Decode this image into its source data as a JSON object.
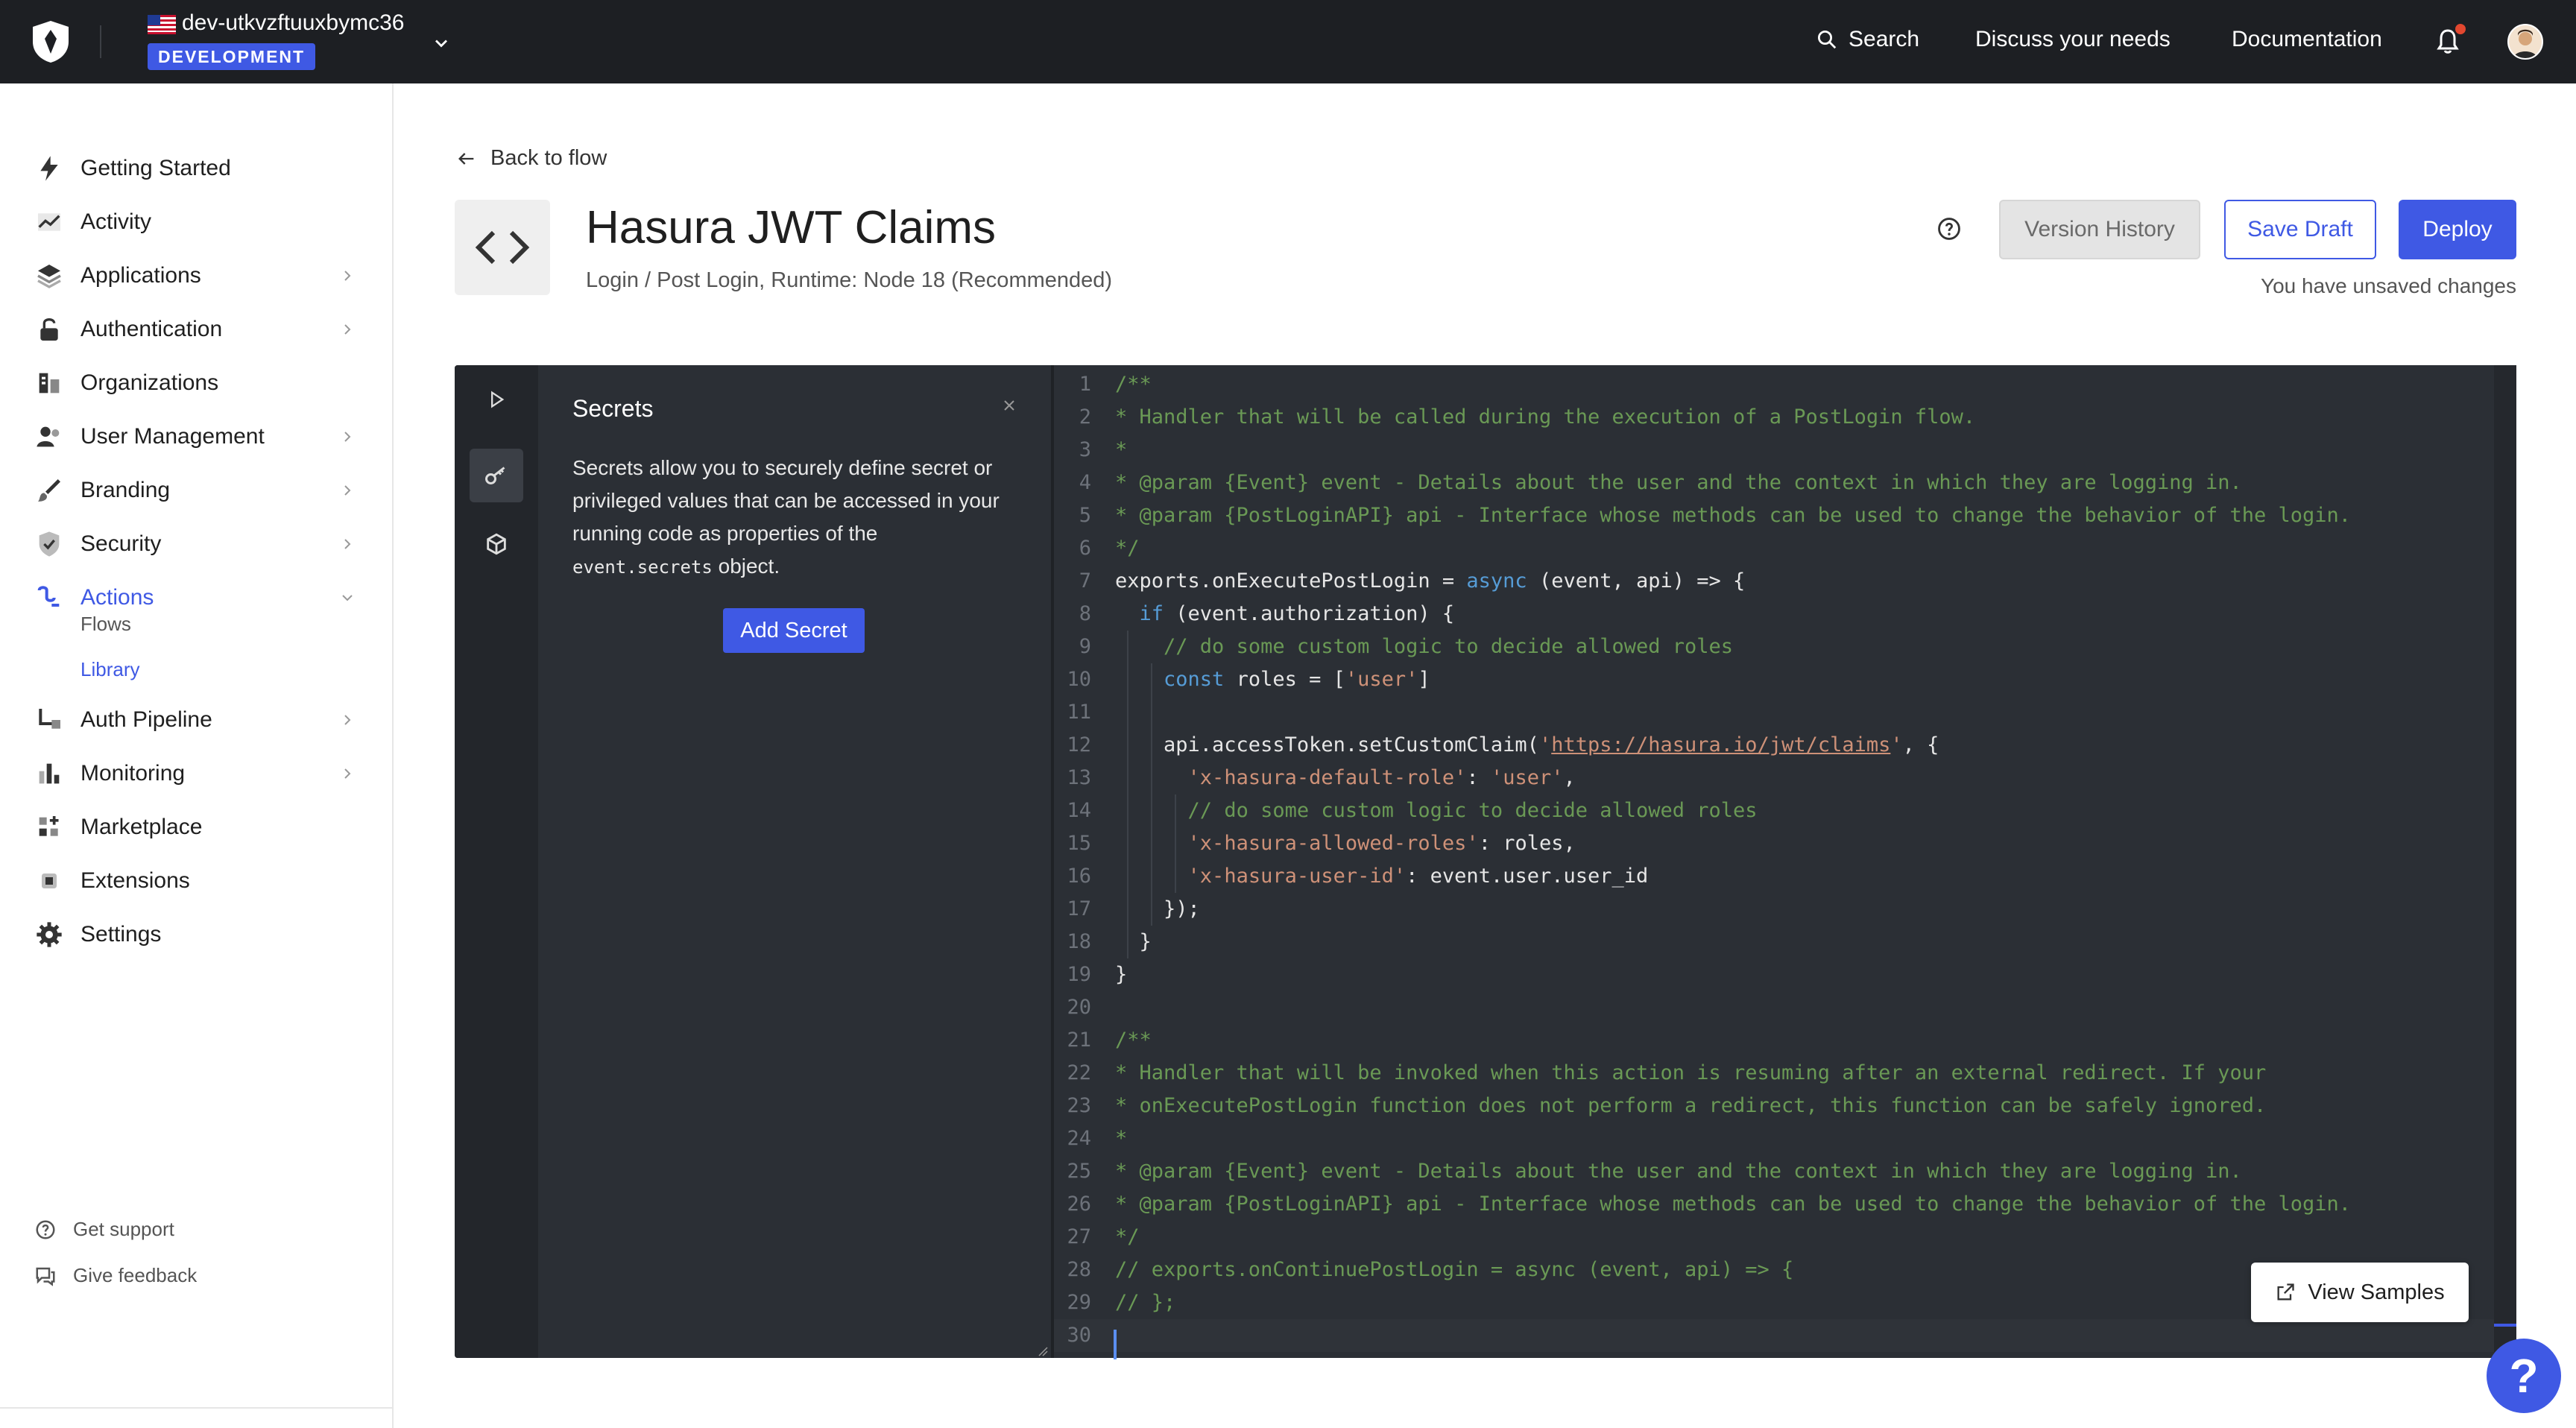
{
  "topbar": {
    "tenant_name": "dev-utkvzftuuxbymc36",
    "env_badge": "DEVELOPMENT",
    "search_label": "Search",
    "discuss_label": "Discuss your needs",
    "docs_label": "Documentation"
  },
  "sidebar": {
    "items": [
      {
        "label": "Getting Started",
        "icon": "bolt-icon",
        "chevron": false
      },
      {
        "label": "Activity",
        "icon": "activity-icon",
        "chevron": false
      },
      {
        "label": "Applications",
        "icon": "layers-icon",
        "chevron": true
      },
      {
        "label": "Authentication",
        "icon": "lock-icon",
        "chevron": true
      },
      {
        "label": "Organizations",
        "icon": "building-icon",
        "chevron": false
      },
      {
        "label": "User Management",
        "icon": "users-icon",
        "chevron": true
      },
      {
        "label": "Branding",
        "icon": "brush-icon",
        "chevron": true
      },
      {
        "label": "Security",
        "icon": "shield-icon",
        "chevron": true
      },
      {
        "label": "Actions",
        "icon": "actions-icon",
        "chevron": true,
        "expanded": true
      },
      {
        "label": "Auth Pipeline",
        "icon": "pipeline-icon",
        "chevron": true
      },
      {
        "label": "Monitoring",
        "icon": "bar-chart-icon",
        "chevron": true
      },
      {
        "label": "Marketplace",
        "icon": "grid-plus-icon",
        "chevron": false
      },
      {
        "label": "Extensions",
        "icon": "chip-icon",
        "chevron": false
      },
      {
        "label": "Settings",
        "icon": "gear-icon",
        "chevron": false
      }
    ],
    "actions_sub": {
      "flows": "Flows",
      "library": "Library"
    },
    "support": "Get support",
    "feedback": "Give feedback"
  },
  "header": {
    "back_label": "Back to flow",
    "title": "Hasura JWT Claims",
    "subtitle": "Login / Post Login, Runtime: Node 18 (Recommended)",
    "version_history": "Version History",
    "save_draft": "Save Draft",
    "deploy": "Deploy",
    "unsaved": "You have unsaved changes"
  },
  "secrets_panel": {
    "title": "Secrets",
    "desc_part1": "Secrets allow you to securely define secret or privileged values that can be accessed in your running code as properties of the ",
    "desc_code": "event.secrets",
    "desc_part2": " object.",
    "add_button": "Add Secret"
  },
  "editor": {
    "view_samples": "View Samples",
    "lines": [
      [
        [
          "cm",
          "/**"
        ]
      ],
      [
        [
          "cm",
          "* Handler that will be called during the execution of a PostLogin flow."
        ]
      ],
      [
        [
          "cm",
          "*"
        ]
      ],
      [
        [
          "cm",
          "* @param {Event} event - Details about the user and the context in which they are logging in."
        ]
      ],
      [
        [
          "cm",
          "* @param {PostLoginAPI} api - Interface whose methods can be used to change the behavior of the login."
        ]
      ],
      [
        [
          "cm",
          "*/"
        ]
      ],
      [
        [
          "",
          "exports.onExecutePostLogin = "
        ],
        [
          "kw",
          "async"
        ],
        [
          "",
          " (event, api) => {"
        ]
      ],
      [
        [
          "",
          "  "
        ],
        [
          "kw",
          "if"
        ],
        [
          "",
          " (event.authorization) {"
        ]
      ],
      [
        [
          "",
          "    "
        ],
        [
          "cm",
          "// do some custom logic to decide allowed roles"
        ]
      ],
      [
        [
          "",
          "    "
        ],
        [
          "kw",
          "const"
        ],
        [
          "",
          " roles = ["
        ],
        [
          "str",
          "'user'"
        ],
        [
          "",
          "]"
        ]
      ],
      [
        [
          "",
          ""
        ]
      ],
      [
        [
          "",
          "    api.accessToken.setCustomClaim("
        ],
        [
          "str",
          "'"
        ],
        [
          "url",
          "https://hasura.io/jwt/claims"
        ],
        [
          "str",
          "'"
        ],
        [
          "",
          ", {"
        ]
      ],
      [
        [
          "",
          "      "
        ],
        [
          "str",
          "'x-hasura-default-role'"
        ],
        [
          "",
          ": "
        ],
        [
          "str",
          "'user'"
        ],
        [
          "",
          ","
        ]
      ],
      [
        [
          "",
          "      "
        ],
        [
          "cm",
          "// do some custom logic to decide allowed roles"
        ]
      ],
      [
        [
          "",
          "      "
        ],
        [
          "str",
          "'x-hasura-allowed-roles'"
        ],
        [
          "",
          ": roles,"
        ]
      ],
      [
        [
          "",
          "      "
        ],
        [
          "str",
          "'x-hasura-user-id'"
        ],
        [
          "",
          ": event.user.user_id"
        ]
      ],
      [
        [
          "",
          "    });"
        ]
      ],
      [
        [
          "",
          "  }"
        ]
      ],
      [
        [
          "",
          "}"
        ]
      ],
      [
        [
          "",
          ""
        ]
      ],
      [
        [
          "cm",
          "/**"
        ]
      ],
      [
        [
          "cm",
          "* Handler that will be invoked when this action is resuming after an external redirect. If your"
        ]
      ],
      [
        [
          "cm",
          "* onExecutePostLogin function does not perform a redirect, this function can be safely ignored."
        ]
      ],
      [
        [
          "cm",
          "*"
        ]
      ],
      [
        [
          "cm",
          "* @param {Event} event - Details about the user and the context in which they are logging in."
        ]
      ],
      [
        [
          "cm",
          "* @param {PostLoginAPI} api - Interface whose methods can be used to change the behavior of the login."
        ]
      ],
      [
        [
          "cm",
          "*/"
        ]
      ],
      [
        [
          "cm",
          "// exports.onContinuePostLogin = async (event, api) => {"
        ]
      ],
      [
        [
          "cm",
          "// };"
        ]
      ],
      [
        [
          "",
          ""
        ]
      ]
    ]
  },
  "colors": {
    "accent": "#3f59e4",
    "topbar_bg": "#1d1f23",
    "editor_bg": "#2b2f35"
  }
}
